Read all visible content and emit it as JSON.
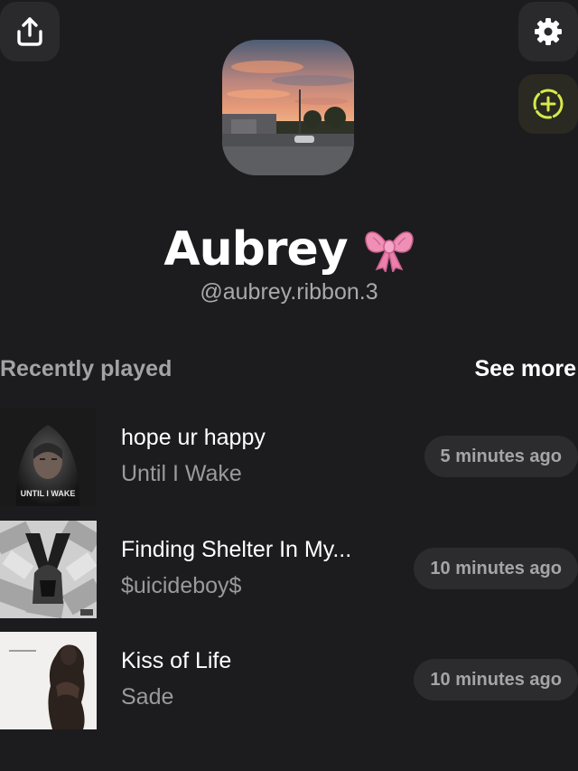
{
  "header": {
    "share_icon": "share-icon",
    "settings_icon": "gear-icon",
    "add_icon": "add-circle-icon",
    "accent_color": "#d7e94a"
  },
  "profile": {
    "display_name": "Aubrey",
    "emoji": "🎀",
    "handle": "@aubrey.ribbon.3"
  },
  "recently_played": {
    "title": "Recently played",
    "see_more": "See more",
    "tracks": [
      {
        "title": "hope ur happy",
        "artist": "Until I Wake",
        "time": "5 minutes ago",
        "art_text": "UNTIL I WAKE"
      },
      {
        "title": "Finding Shelter In My...",
        "artist": "$uicideboy$",
        "time": "10 minutes ago"
      },
      {
        "title": "Kiss of Life",
        "artist": "Sade",
        "time": "10 minutes ago"
      }
    ]
  }
}
